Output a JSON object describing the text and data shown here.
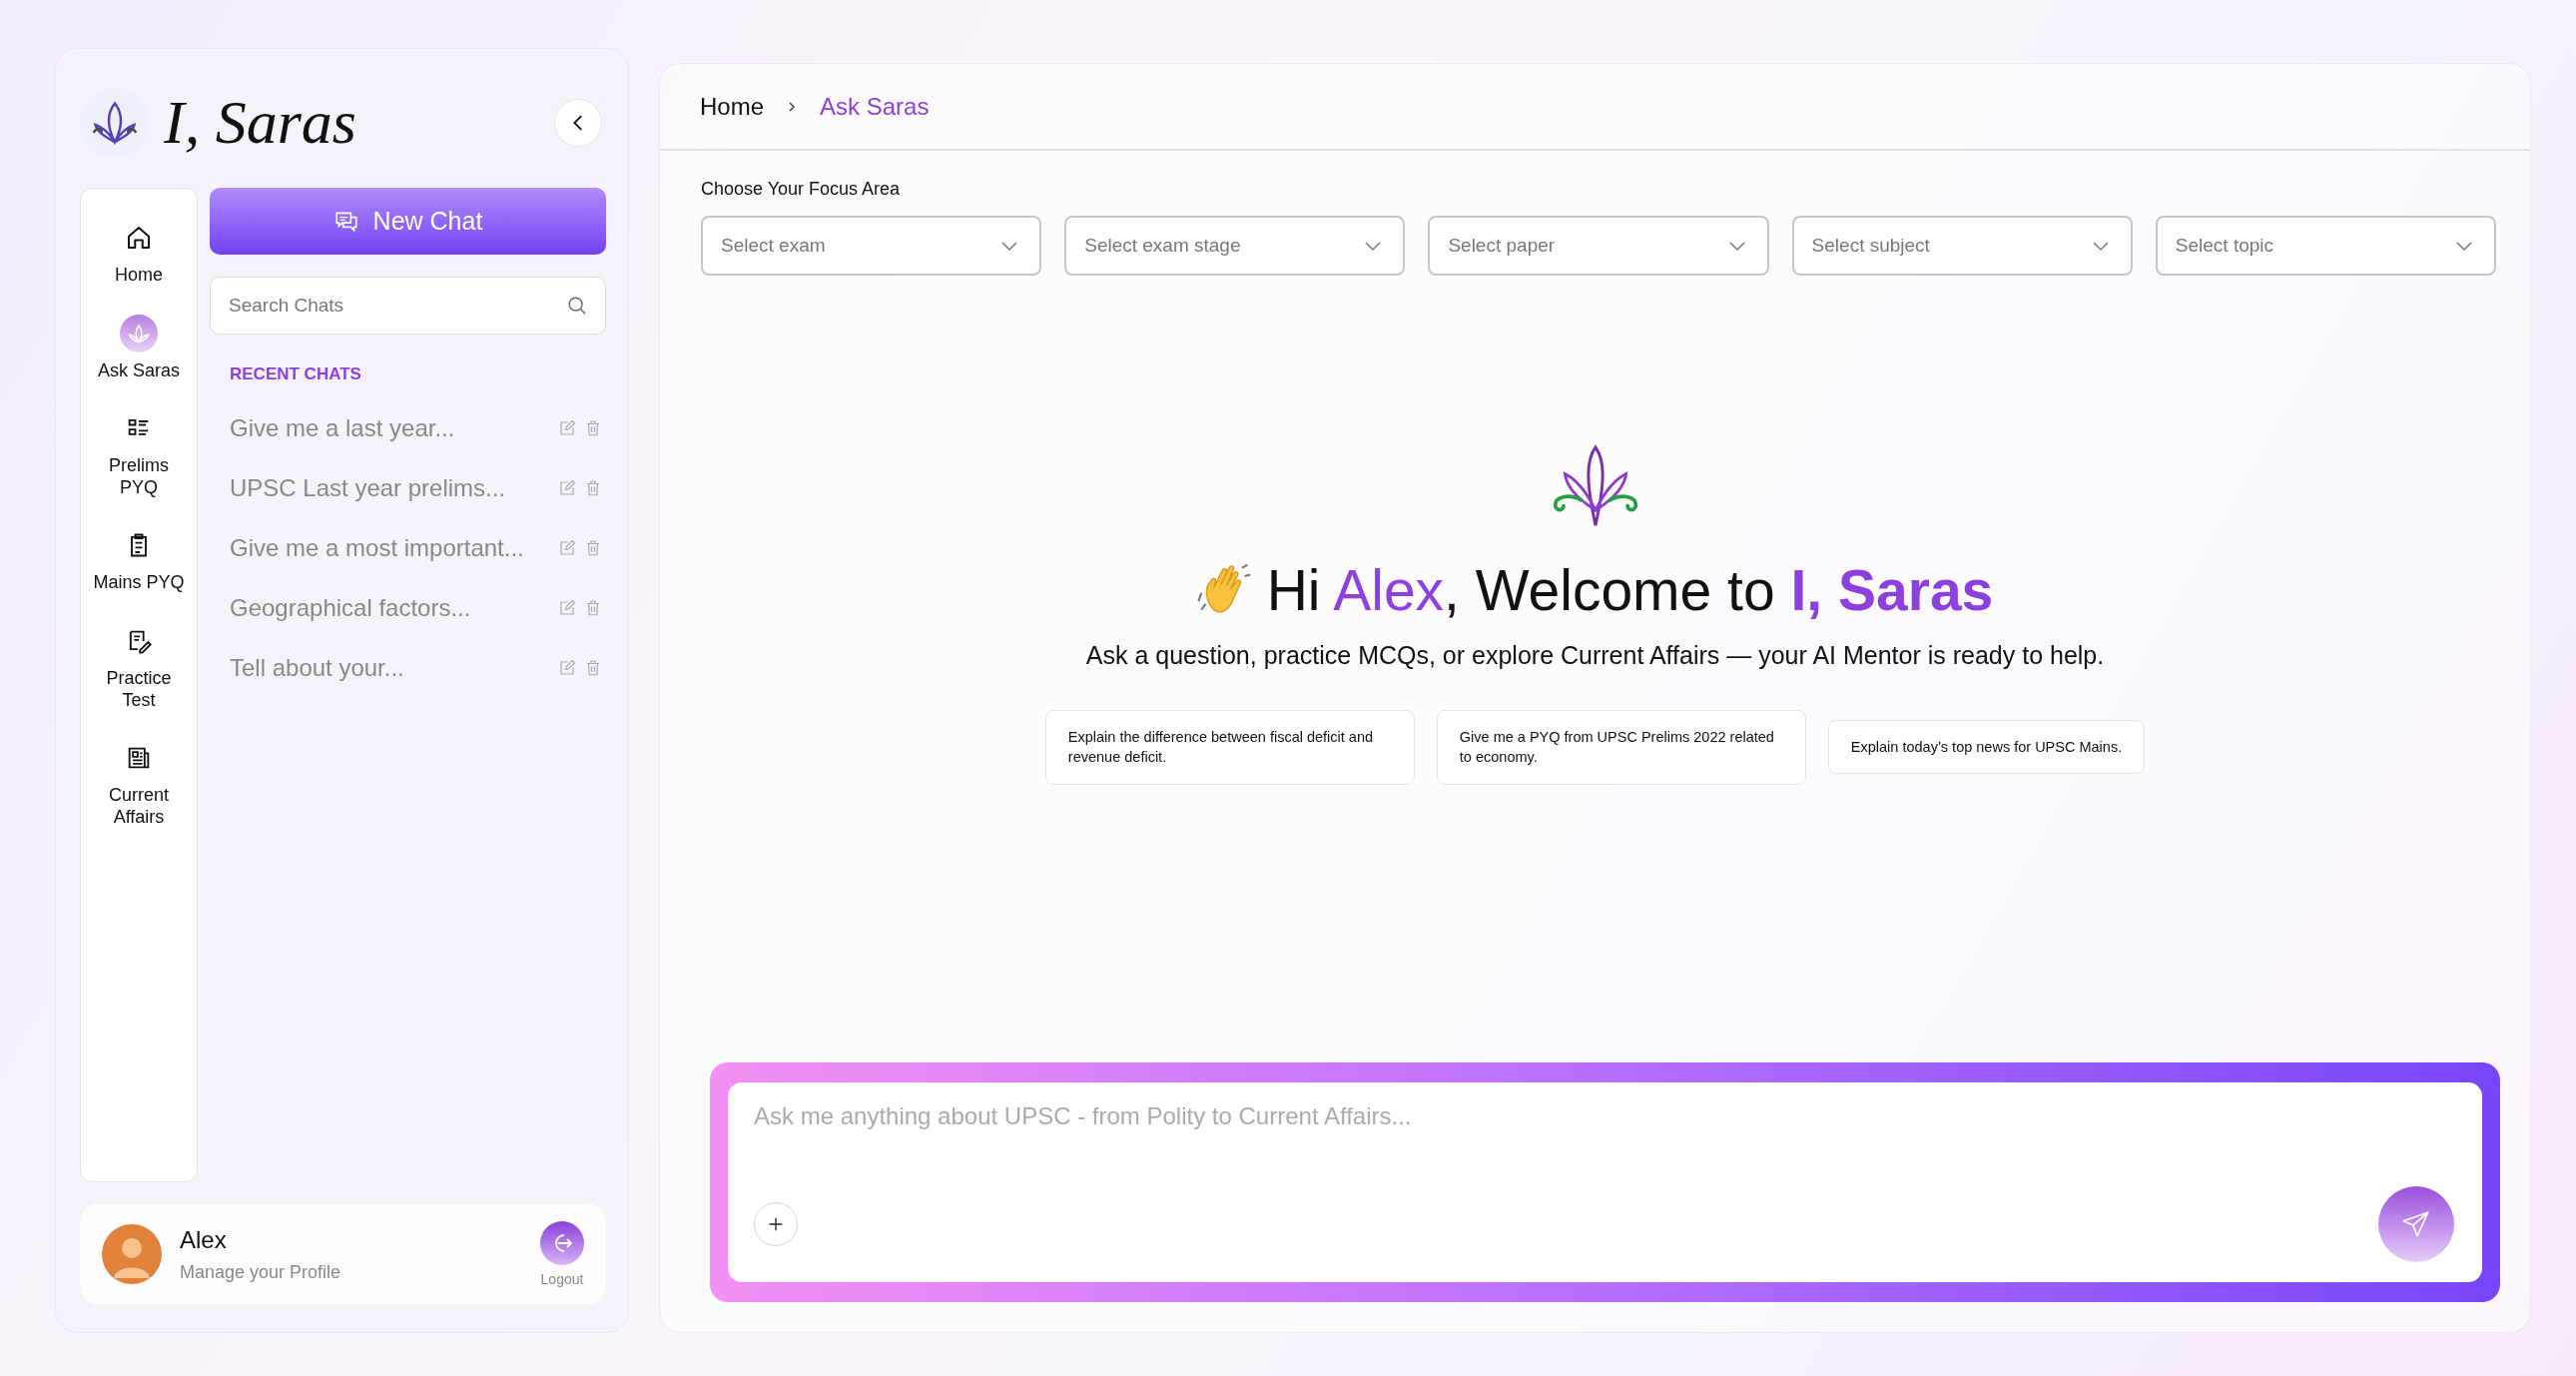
{
  "brand": {
    "name": "I, Saras"
  },
  "nav": [
    {
      "label": "Home",
      "selected": false
    },
    {
      "label": "Ask Saras",
      "selected": true
    },
    {
      "label": "Prelims PYQ",
      "selected": false
    },
    {
      "label": "Mains PYQ",
      "selected": false
    },
    {
      "label": "Practice Test",
      "selected": false
    },
    {
      "label": "Current Affairs",
      "selected": false
    }
  ],
  "new_chat": "New Chat",
  "search": {
    "placeholder": "Search Chats"
  },
  "recent": {
    "heading": "RECENT CHATS",
    "items": [
      "Give me a last year...",
      "UPSC Last year prelims...",
      "Give me a most important...",
      "Geographical factors...",
      "Tell about your..."
    ]
  },
  "profile": {
    "name": "Alex",
    "subtitle": "Manage your Profile",
    "logout": "Logout"
  },
  "breadcrumb": [
    {
      "label": "Home",
      "selected": false
    },
    {
      "label": "Ask Saras",
      "selected": true
    }
  ],
  "focus": {
    "label": "Choose Your Focus Area",
    "dropdowns": [
      "Select exam",
      "Select exam stage",
      "Select paper",
      "Select subject",
      "Select topic"
    ]
  },
  "welcome": {
    "heading": [
      {
        "text": "Hi ",
        "accent": false
      },
      {
        "text": "Alex",
        "accent": true
      },
      {
        "text": ", Welcome to ",
        "accent": false
      },
      {
        "text": "**I, Saras**",
        "accent": true
      }
    ],
    "subtitle": "Ask a question, practice MCQs, or explore Current Affairs — your AI Mentor is ready to help.",
    "suggestions": [
      "Explain the difference between fiscal deficit and revenue deficit.",
      "Give me a PYQ from UPSC Prelims 2022 related to economy.",
      "Explain today’s top news for UPSC Mains."
    ]
  },
  "composer": {
    "placeholder": "Ask me anything about UPSC - from Polity to Current Affairs..."
  }
}
